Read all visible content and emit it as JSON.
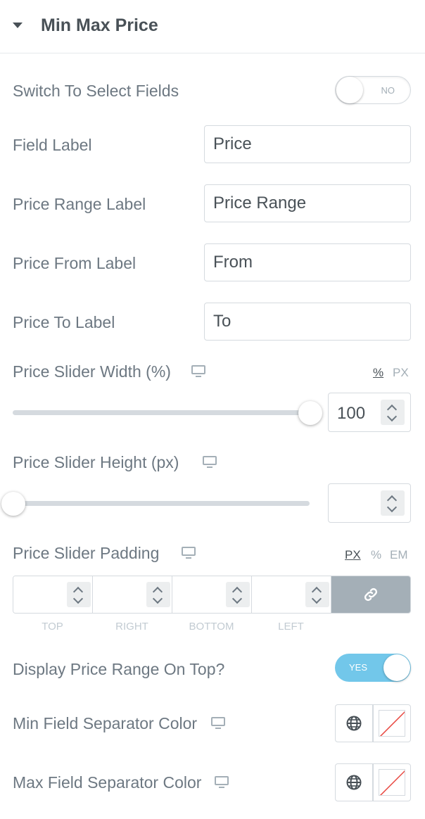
{
  "section": {
    "title": "Min Max Price"
  },
  "switch_select_fields": {
    "label": "Switch To Select Fields",
    "state": "NO"
  },
  "fields": [
    {
      "label": "Field Label",
      "value": "Price"
    },
    {
      "label": "Price Range Label",
      "value": "Price Range"
    },
    {
      "label": "Price From Label",
      "value": "From"
    },
    {
      "label": "Price To Label",
      "value": "To"
    }
  ],
  "slider_width": {
    "label": "Price Slider Width (%)",
    "units": [
      "%",
      "PX"
    ],
    "active_unit": "%",
    "value": "100",
    "fraction": 1.0
  },
  "slider_height": {
    "label": "Price Slider Height (px)",
    "value": "",
    "fraction": 0.0
  },
  "slider_padding": {
    "label": "Price Slider Padding",
    "units": [
      "PX",
      "%",
      "EM"
    ],
    "active_unit": "PX",
    "sides": [
      "TOP",
      "RIGHT",
      "BOTTOM",
      "LEFT"
    ]
  },
  "display_range_top": {
    "label": "Display Price Range On Top?",
    "state": "YES"
  },
  "min_separator": {
    "label": "Min Field Separator Color"
  },
  "max_separator": {
    "label": "Max Field Separator Color"
  },
  "colors": {
    "toggle_on": "#72c7ea",
    "link_button": "#a4afb7",
    "unset_swatch_line": "#e8463f"
  },
  "icons": [
    "caret-down-icon",
    "desktop-icon",
    "chevron-up-icon",
    "chevron-down-icon",
    "link-icon",
    "globe-icon"
  ]
}
